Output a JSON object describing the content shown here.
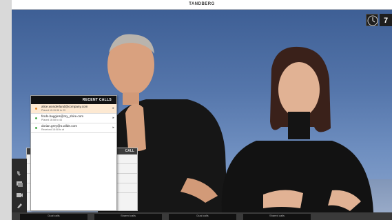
{
  "header": {
    "brand": "TANDBERG"
  },
  "clock": {
    "badge": "7"
  },
  "recent_calls": {
    "title": "RECENT CALLS",
    "items": [
      {
        "address": "alice.wonderland@company.com",
        "detail": "Placed 15:15:38 to 29",
        "status_color": "#e88a2a",
        "selected": true
      },
      {
        "address": "frodo.baggins@my_shire.com",
        "detail": "Placed 16:08 to 44",
        "status_color": "#4caf50",
        "selected": false
      },
      {
        "address": "dorian.grey@o.wilde.com",
        "detail": "Received 16:08 to at",
        "status_color": "#4caf50",
        "selected": false
      }
    ]
  },
  "background_menu": {
    "header": "CALL"
  },
  "bottom_tabs": [
    "Dual calls",
    "Shared calls",
    "Dual calls",
    "Shared calls"
  ]
}
